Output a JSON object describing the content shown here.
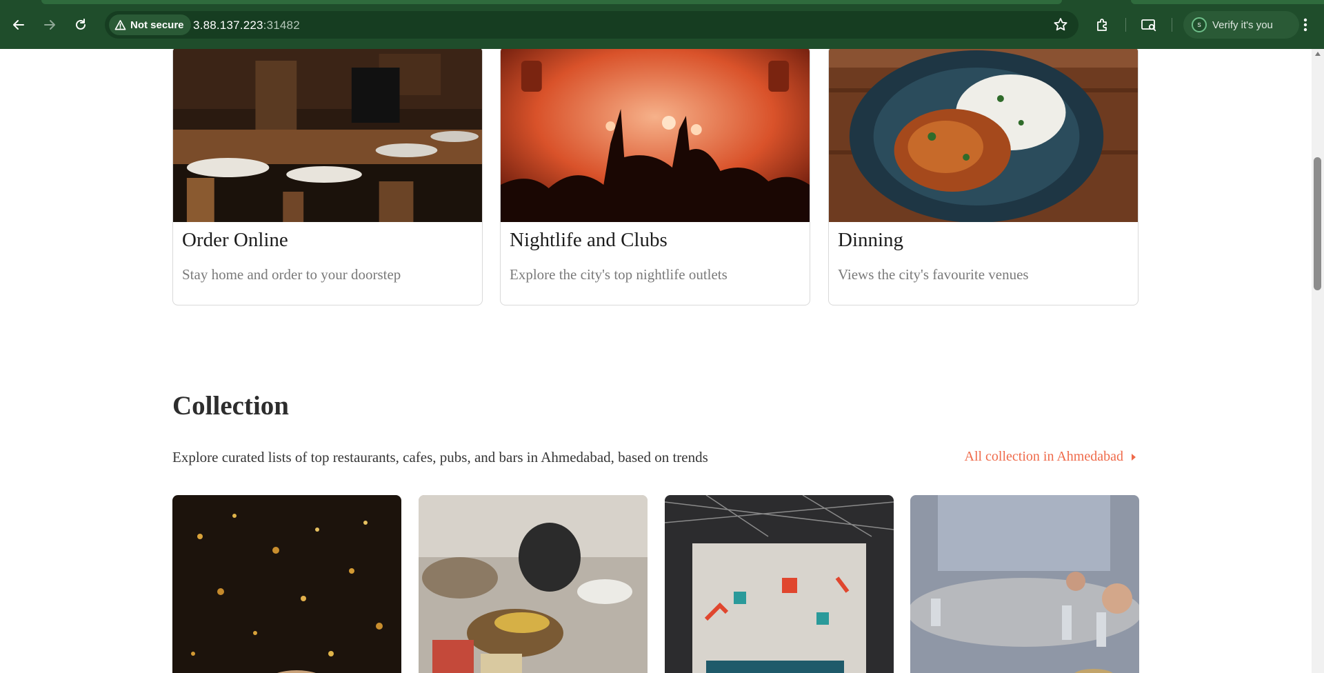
{
  "browser": {
    "security_label": "Not secure",
    "url_host": "3.88.137.223",
    "url_port": ":31482",
    "profile_label": "Verify it's you",
    "profile_initial": "S"
  },
  "feature_cards": [
    {
      "title": "Order Online",
      "description": "Stay home and order to your doorstep",
      "image": "restaurant-dining-room"
    },
    {
      "title": "Nightlife and Clubs",
      "description": "Explore the city's top nightlife outlets",
      "image": "concert-crowd"
    },
    {
      "title": "Dinning",
      "description": "Views the city's favourite venues",
      "image": "curry-and-rice-plate"
    }
  ],
  "collection": {
    "title": "Collection",
    "subtitle": "Explore curated lists of top restaurants, cafes, pubs, and bars in Ahmedabad, based on trends",
    "link_label": "All collection in Ahmedabad",
    "items": [
      {
        "image": "festive-lights"
      },
      {
        "image": "buffet-spread"
      },
      {
        "image": "cafe-mural-interior"
      },
      {
        "image": "banquet-table-setting"
      }
    ]
  },
  "colors": {
    "chrome_bg": "#1f4d2b",
    "accent_link": "#ef6a4a",
    "card_border": "#d9d9d9"
  }
}
